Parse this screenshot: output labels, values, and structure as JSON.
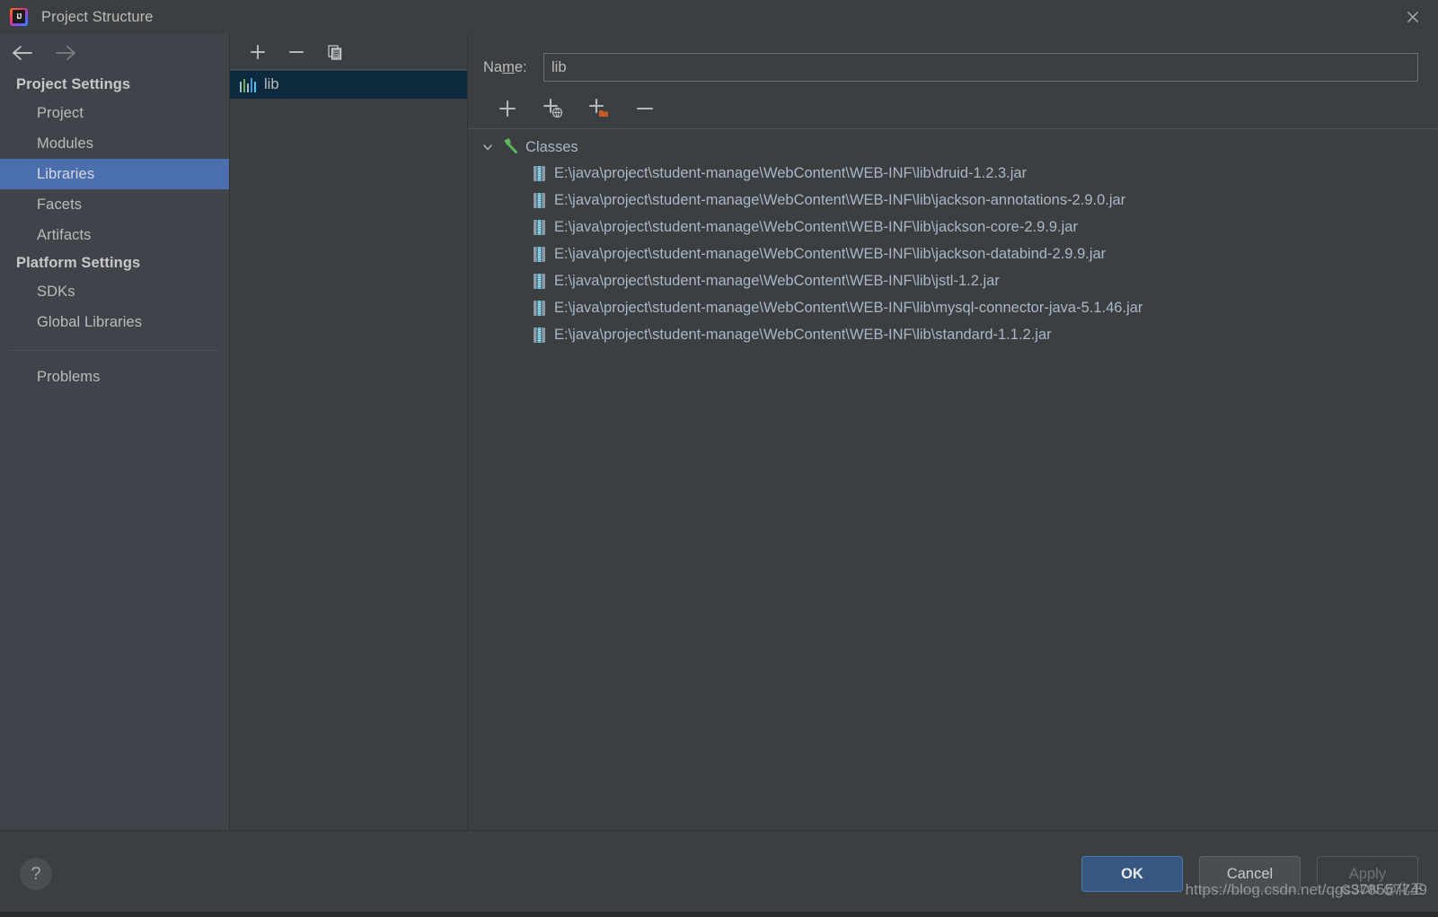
{
  "window": {
    "title": "Project Structure",
    "app_icon": "intellij-idea-icon",
    "close_icon": "close-icon"
  },
  "sidebar": {
    "back_icon": "arrow-left-icon",
    "forward_icon": "arrow-right-icon",
    "groups": [
      {
        "header": "Project Settings",
        "items": [
          {
            "label": "Project",
            "selected": false
          },
          {
            "label": "Modules",
            "selected": false
          },
          {
            "label": "Libraries",
            "selected": true
          },
          {
            "label": "Facets",
            "selected": false
          },
          {
            "label": "Artifacts",
            "selected": false
          }
        ]
      },
      {
        "header": "Platform Settings",
        "items": [
          {
            "label": "SDKs",
            "selected": false
          },
          {
            "label": "Global Libraries",
            "selected": false
          }
        ]
      }
    ],
    "extra_items": [
      {
        "label": "Problems",
        "selected": false
      }
    ],
    "selection_color": "#4b6eaf"
  },
  "library_list": {
    "toolbar": [
      {
        "name": "add-library-button",
        "icon": "plus-icon"
      },
      {
        "name": "remove-library-button",
        "icon": "minus-icon"
      },
      {
        "name": "copy-library-button",
        "icon": "copy-icon"
      }
    ],
    "items": [
      {
        "label": "lib",
        "icon": "library-icon",
        "selected": true
      }
    ],
    "selection_color": "#0d293e"
  },
  "detail": {
    "name_label_pre": "Na",
    "name_label_mnemonic": "m",
    "name_label_post": "e:",
    "name_value": "lib",
    "name_placeholder": "",
    "toolbar": [
      {
        "name": "add-classes-button",
        "icon": "plus-icon"
      },
      {
        "name": "add-from-maven-button",
        "icon": "plus-globe-icon"
      },
      {
        "name": "add-from-folder-button",
        "icon": "plus-folder-icon"
      },
      {
        "name": "remove-entry-button",
        "icon": "minus-icon"
      }
    ],
    "tree": {
      "root": {
        "label": "Classes",
        "icon": "hammer-icon",
        "expanded": true,
        "chevron_icon": "chevron-down-icon"
      },
      "entries": [
        {
          "path": "E:\\java\\project\\student-manage\\WebContent\\WEB-INF\\lib\\druid-1.2.3.jar",
          "icon": "jar-icon"
        },
        {
          "path": "E:\\java\\project\\student-manage\\WebContent\\WEB-INF\\lib\\jackson-annotations-2.9.0.jar",
          "icon": "jar-icon"
        },
        {
          "path": "E:\\java\\project\\student-manage\\WebContent\\WEB-INF\\lib\\jackson-core-2.9.9.jar",
          "icon": "jar-icon"
        },
        {
          "path": "E:\\java\\project\\student-manage\\WebContent\\WEB-INF\\lib\\jackson-databind-2.9.9.jar",
          "icon": "jar-icon"
        },
        {
          "path": "E:\\java\\project\\student-manage\\WebContent\\WEB-INF\\lib\\jstl-1.2.jar",
          "icon": "jar-icon"
        },
        {
          "path": "E:\\java\\project\\student-manage\\WebContent\\WEB-INF\\lib\\mysql-connector-java-5.1.46.jar",
          "icon": "jar-icon"
        },
        {
          "path": "E:\\java\\project\\student-manage\\WebContent\\WEB-INF\\lib\\standard-1.1.2.jar",
          "icon": "jar-icon"
        }
      ]
    }
  },
  "footer": {
    "help_label": "?",
    "ok_label": "OK",
    "cancel_label": "Cancel",
    "apply_label": "Apply",
    "apply_disabled": true,
    "ok_color": "#365880"
  },
  "watermark": {
    "url": "https://blog.csdn.net/qgs378557749",
    "overlay": "CSDN @化王"
  }
}
